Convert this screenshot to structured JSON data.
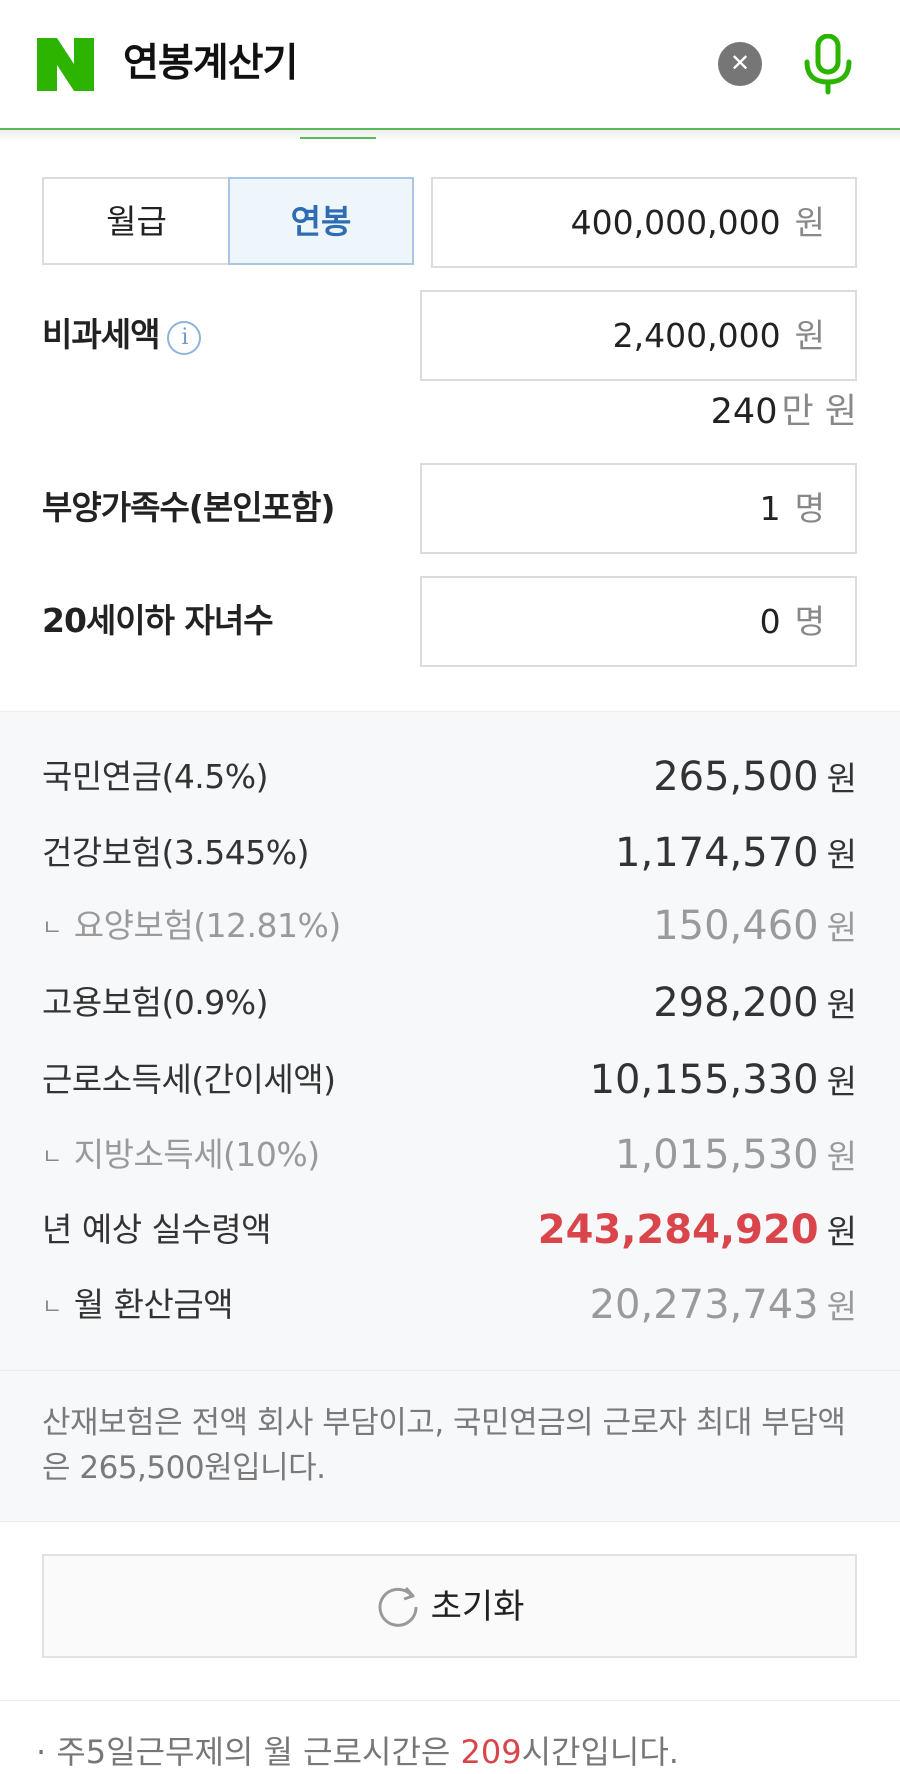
{
  "header": {
    "logo": "N",
    "title": "연봉계산기",
    "clear_icon": "close-icon",
    "mic_icon": "microphone-icon",
    "brand_color": "#2db400"
  },
  "mode_toggle": {
    "options": [
      "월급",
      "연봉"
    ],
    "selected": "연봉"
  },
  "salary": {
    "value": "400,000,000",
    "unit": "원"
  },
  "nontax": {
    "label": "비과세액",
    "info_icon": "info-icon",
    "value": "2,400,000",
    "unit": "원",
    "helper_amount": "240",
    "helper_unit": "만 원"
  },
  "dependents": {
    "label": "부양가족수(본인포함)",
    "value": "1",
    "unit": "명"
  },
  "children": {
    "label": "20세이하 자녀수",
    "value": "0",
    "unit": "명"
  },
  "results": {
    "sub_marker": "ㄴ",
    "pension": {
      "label": "국민연금(4.5%)",
      "amount": "265,500",
      "unit": "원"
    },
    "health": {
      "label": "건강보험(3.545%)",
      "amount": "1,174,570",
      "unit": "원"
    },
    "care": {
      "label": "요양보험(12.81%)",
      "amount": "150,460",
      "unit": "원"
    },
    "employment": {
      "label": "고용보험(0.9%)",
      "amount": "298,200",
      "unit": "원"
    },
    "income_tax": {
      "label": "근로소득세(간이세액)",
      "amount": "10,155,330",
      "unit": "원"
    },
    "local_tax": {
      "label": "지방소득세(10%)",
      "amount": "1,015,530",
      "unit": "원"
    },
    "annual_net": {
      "label": "년 예상 실수령액",
      "amount": "243,284,920",
      "unit": "원",
      "color": "#d9454a"
    },
    "monthly_net": {
      "label": "월 환산금액",
      "amount": "20,273,743",
      "unit": "원"
    }
  },
  "note": "산재보험은 전액 회사 부담이고, 국민연금의 근로자 최대 부담액은 265,500원입니다.",
  "reset": {
    "label": "초기화",
    "icon": "refresh-icon"
  },
  "footnote": {
    "prefix": "· 주5일근무제의 월 근로시간은 ",
    "hours": "209",
    "suffix": "시간입니다."
  }
}
